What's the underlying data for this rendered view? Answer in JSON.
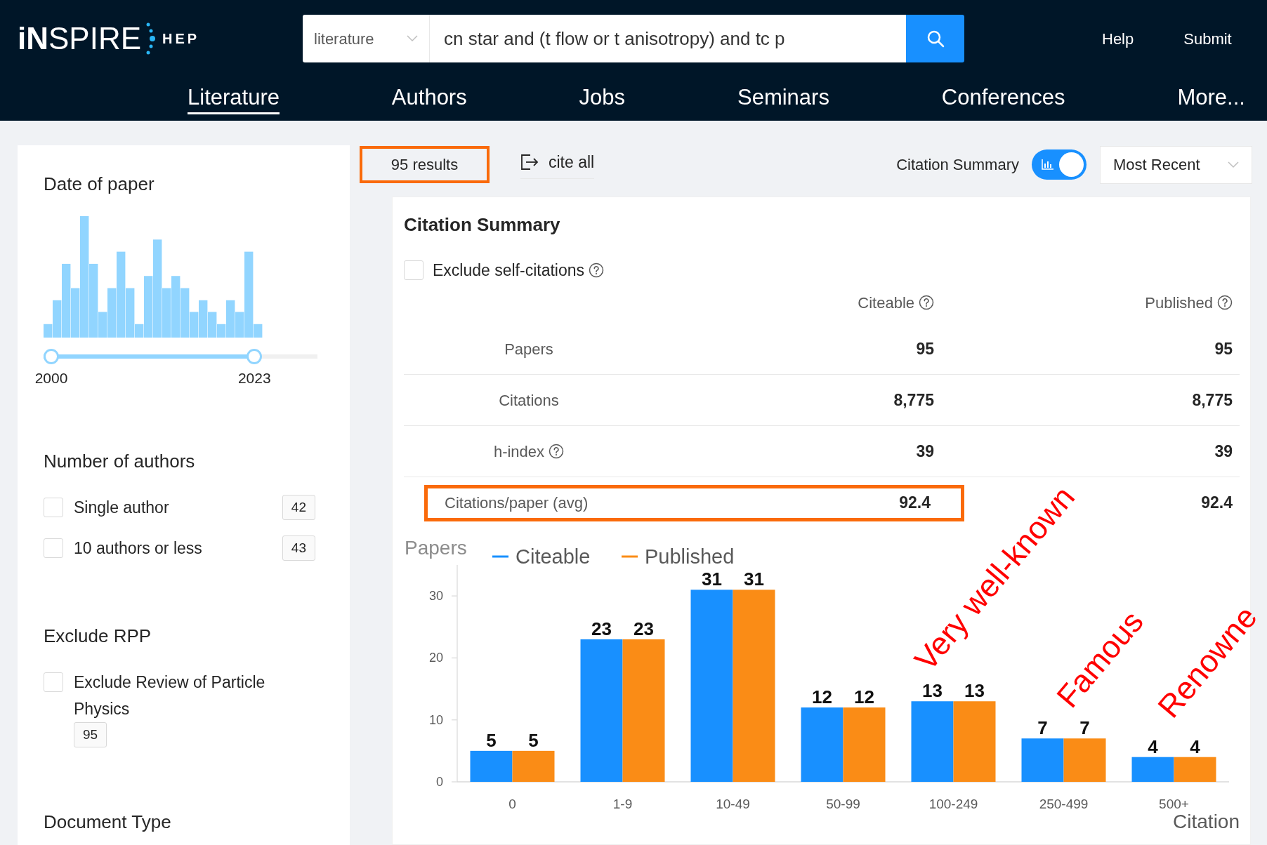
{
  "header": {
    "logo_text": "**iN**SPIRE",
    "logo_suffix": "HEP",
    "search": {
      "scope": "literature",
      "query": "cn star and (t flow or t anisotropy) and tc p"
    },
    "links": [
      {
        "label": "Help"
      },
      {
        "label": "Submit"
      }
    ]
  },
  "nav": [
    {
      "label": "Literature",
      "selected": true
    },
    {
      "label": "Authors",
      "selected": false
    },
    {
      "label": "Jobs",
      "selected": false
    },
    {
      "label": "Seminars",
      "selected": false
    },
    {
      "label": "Conferences",
      "selected": false
    },
    {
      "label": "More...",
      "selected": false
    }
  ],
  "sidebar": {
    "date_filter": {
      "title": "Date of paper",
      "range": {
        "level": 0.77,
        "start_label": "2000",
        "end_label": "2023"
      }
    },
    "filters": [
      {
        "title": "Number of authors",
        "options": [
          {
            "label": "Single author",
            "count": "42",
            "checked": false
          },
          {
            "label": "10 authors or less",
            "count": "43",
            "checked": false
          }
        ]
      },
      {
        "title": "Exclude RPP",
        "options": [
          {
            "label": "Exclude Review of Particle Physics",
            "count": "95",
            "checked": false
          }
        ]
      },
      {
        "title": "Document Type"
      }
    ]
  },
  "results_bar": {
    "count": "95 results",
    "highlighted": true,
    "cite_all": "cite all",
    "summary_toggle": {
      "label": "Citation Summary",
      "on": true
    },
    "sort": "Most Recent"
  },
  "citation_summary": {
    "title": "Citation Summary",
    "exclude_self": {
      "label": "Exclude self-citations",
      "checked": false
    },
    "columns": [
      {
        "label": "Citeable",
        "help": true
      },
      {
        "label": "Published",
        "help": true
      }
    ],
    "rows": [
      {
        "label": "Papers",
        "help": false,
        "citeable": "95",
        "published": "95",
        "highlighted": false
      },
      {
        "label": "Citations",
        "help": false,
        "citeable": "8,775",
        "published": "8,775",
        "highlighted": false
      },
      {
        "label": "h-index",
        "help": true,
        "citeable": "39",
        "published": "39",
        "highlighted": false
      },
      {
        "label": "Citations/paper (avg)",
        "help": false,
        "citeable": "92.4",
        "published": "92.4",
        "highlighted": true
      }
    ],
    "chart_data": {
      "type": "bar",
      "xlabel": "Citation",
      "ylabel": "Papers",
      "categories": [
        "0",
        "1-9",
        "10-49",
        "50-99",
        "100-249",
        "250-499",
        "500+"
      ],
      "series": [
        {
          "name": "Citeable",
          "color": "#1890ff",
          "values": [
            5,
            23,
            31,
            12,
            13,
            7,
            4
          ]
        },
        {
          "name": "Published",
          "color": "#fa8c16",
          "values": [
            5,
            23,
            31,
            12,
            13,
            7,
            4
          ]
        }
      ],
      "ylim": [
        0,
        35
      ],
      "yticks": [
        0,
        10,
        20,
        30
      ],
      "data_labels": true,
      "legend": "top"
    }
  },
  "annotations": [
    {
      "text": "Very well-known"
    },
    {
      "text": "Famous"
    },
    {
      "text": "Renowne"
    }
  ]
}
